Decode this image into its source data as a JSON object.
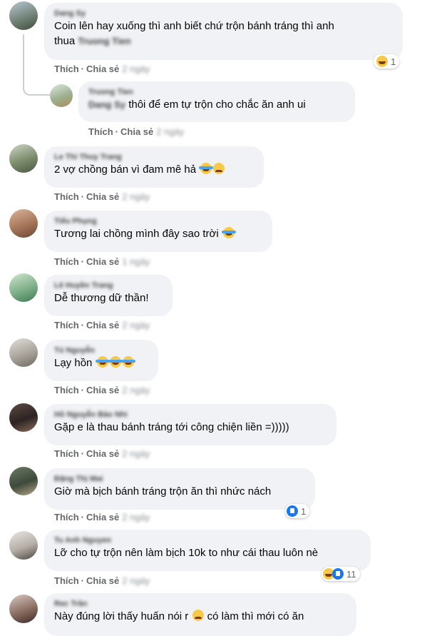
{
  "labels": {
    "like": "Thích",
    "reply": "Chia sẻ",
    "sep": "·"
  },
  "comments": [
    {
      "name": "Dang Sy",
      "text": "Coin lên hay xuống thì anh biết chứ trộn bánh tráng thì anh",
      "text2": "thua",
      "tag": "Truong Tien",
      "time": "2 ngày",
      "reaction_count": "1",
      "reaction_icon": "haha-icon"
    },
    {
      "name": "Truong Tien",
      "tag": "Dang Sy",
      "text": "thôi để em tự trộn cho chắc ăn anh ui",
      "time": "2 ngày"
    },
    {
      "name": "Le Thi Thuy Trang",
      "text": "2 vợ chồng bán vì đam mê hả",
      "time": "2 ngày"
    },
    {
      "name": "Tiểu Phụng",
      "text": "Tương lai chồng mình đây sao trời",
      "time": "1 ngày"
    },
    {
      "name": "Lê Huyền Trang",
      "text": "Dễ thương dữ thần!",
      "time": "2 ngày"
    },
    {
      "name": "Tú Nguyễn",
      "text": "Lạy hồn",
      "time": "2 ngày"
    },
    {
      "name": "Hồ Nguyễn Bảo Nhi",
      "text": "Gặp e là thau bánh tráng tới công chiện liền =)))))",
      "time": "2 ngày"
    },
    {
      "name": "Đặng Thị Mai",
      "text": "Giờ mà bịch bánh tráng trộn ăn thì nhức nách",
      "time": "2 ngày",
      "reaction_count": "1",
      "reaction_icon": "like-icon"
    },
    {
      "name": "Tu Anh Nguyen",
      "text": "Lỡ cho tự trộn nên làm bịch 10k to như cái thau luôn nè",
      "time": "2 ngày",
      "reaction_count": "11",
      "reaction_icon": "haha-like-icon"
    },
    {
      "name": "Rec Trần",
      "text": "Này đúng lời thấy huấn nói r",
      "text2": "có làm thì mới có ăn"
    }
  ]
}
